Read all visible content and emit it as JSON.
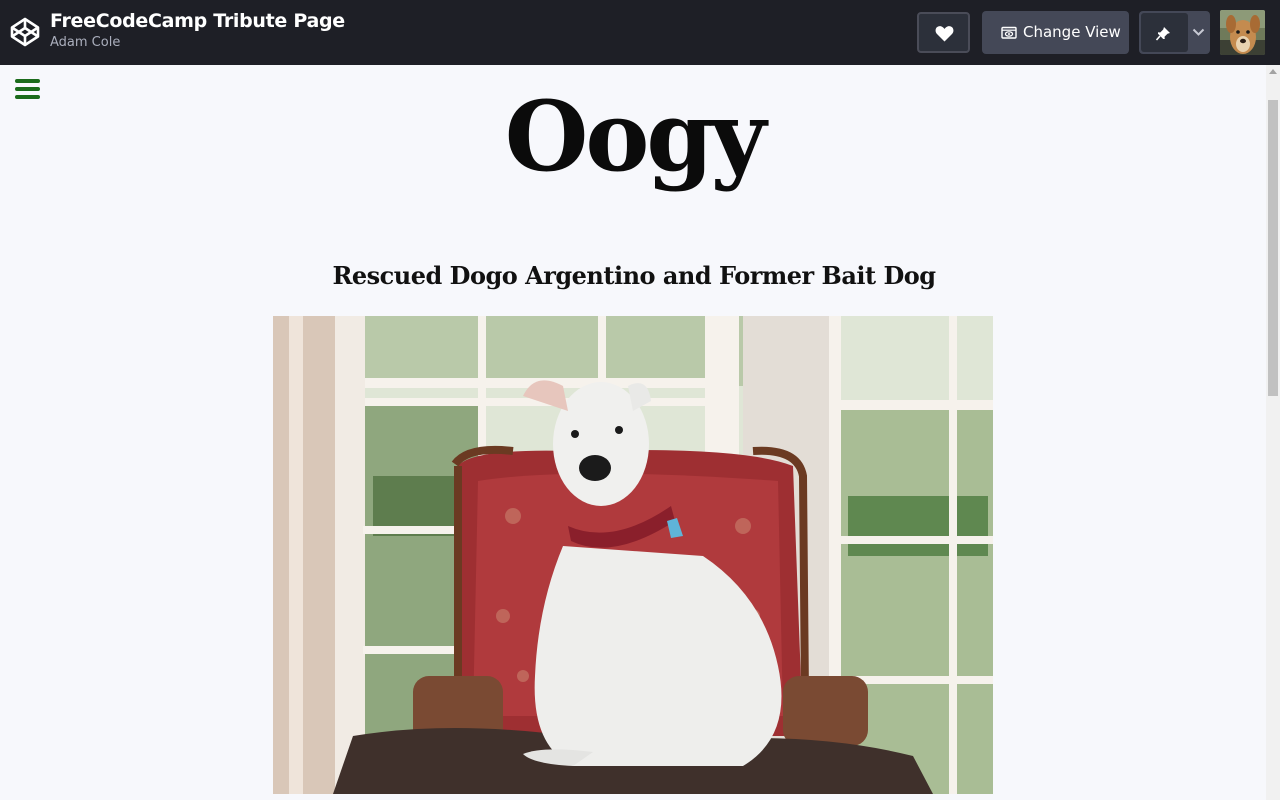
{
  "header": {
    "pen_title": "FreeCodeCamp Tribute Page",
    "author": "Adam Cole",
    "change_view_label": "Change View",
    "icons": [
      "codepen-logo-icon",
      "heart-icon",
      "eye-icon",
      "pin-icon",
      "chevron-down-icon"
    ],
    "colors": {
      "bar": "#1e1f26",
      "button": "#444857"
    }
  },
  "page": {
    "title": "Oogy",
    "subtitle": "Rescued Dogo Argentino and Former Bait Dog",
    "menu_icon": "hamburger-menu-icon",
    "menu_color": "#1b6b1b"
  }
}
